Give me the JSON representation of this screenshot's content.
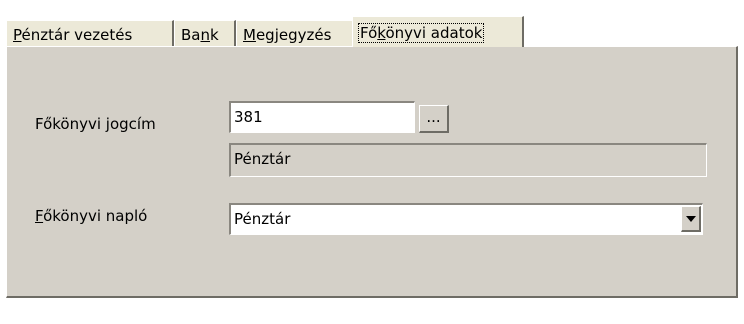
{
  "tabs": [
    {
      "pre": "",
      "ul": "P",
      "post": "énztár vezetés"
    },
    {
      "pre": "Ba",
      "ul": "n",
      "post": "k"
    },
    {
      "pre": "",
      "ul": "M",
      "post": "egjegyzés"
    },
    {
      "pre": "Fő",
      "ul": "k",
      "post": "önyvi adatok"
    }
  ],
  "active_tab": "Főkönyvi adatok",
  "form": {
    "jogcim_label": "Főkönyvi jogcím",
    "jogcim_value": "381",
    "browse_label": "...",
    "jogcim_name": "Pénztár",
    "naplo_label_ul": "F",
    "naplo_label_rest": "őkönyvi napló",
    "naplo_value": "Pénztár"
  }
}
